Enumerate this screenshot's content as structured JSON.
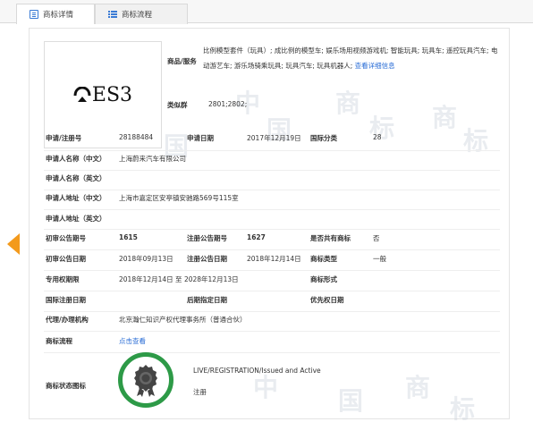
{
  "tabs": [
    {
      "label": "商标详情",
      "icon": "detail-icon",
      "active": true
    },
    {
      "label": "商标流程",
      "icon": "list-icon",
      "active": false
    }
  ],
  "trademark": {
    "logo_text": "ES3",
    "goods_label": "商品/服务",
    "goods_text": "比例模型套件（玩具）; 成比例的模型车; 娱乐场用视频游戏机; 智能玩具; 玩具车; 遥控玩具汽车; 电动游艺车; 游乐场骑乘玩具; 玩具汽车; 玩具机器人;",
    "goods_link": "查看详细信息",
    "similar_label": "类似群",
    "similar_value": "2801;2802;"
  },
  "fields": {
    "reg_no_label": "申请/注册号",
    "reg_no": "28188484",
    "app_date_label": "申请日期",
    "app_date": "2017年12月19日",
    "intl_class_label": "国际分类",
    "intl_class": "28",
    "applicant_cn_label": "申请人名称（中文）",
    "applicant_cn": "上海蔚来汽车有限公司",
    "applicant_en_label": "申请人名称（英文）",
    "applicant_en": "",
    "address_cn_label": "申请人地址（中文）",
    "address_cn": "上海市嘉定区安亭镇安驰路569号115室",
    "address_en_label": "申请人地址（英文）",
    "address_en": "",
    "prelim_pub_no_label": "初审公告期号",
    "prelim_pub_no": "1615",
    "reg_pub_no_label": "注册公告期号",
    "reg_pub_no": "1627",
    "shared_label": "是否共有商标",
    "shared": "否",
    "prelim_pub_date_label": "初审公告日期",
    "prelim_pub_date": "2018年09月13日",
    "reg_pub_date_label": "注册公告日期",
    "reg_pub_date": "2018年12月14日",
    "tm_type_label": "商标类型",
    "tm_type": "一般",
    "exclusive_label": "专用权期限",
    "exclusive_period": "2018年12月14日 至 2028年12月13日",
    "tm_form_label": "商标形式",
    "tm_form": "",
    "intl_reg_date_label": "国际注册日期",
    "intl_reg_date": "",
    "later_date_label": "后期指定日期",
    "later_date": "",
    "priority_label": "优先权日期",
    "priority_date": "",
    "agent_label": "代理/办理机构",
    "agent": "北京瀚仁知识产权代理事务所（普通合伙）",
    "process_label": "商标流程",
    "process_link": "点击查看",
    "status_label": "商标状态图标",
    "status_en": "LIVE/REGISTRATION/Issued and Active",
    "status_cn": "注册"
  },
  "watermark": [
    "中",
    "国",
    "商",
    "标"
  ],
  "colors": {
    "link": "#2a6dd6",
    "prev_arrow": "#f39a1c",
    "next_arrow": "#3a7bd5",
    "status_ring": "#2d9a47"
  }
}
